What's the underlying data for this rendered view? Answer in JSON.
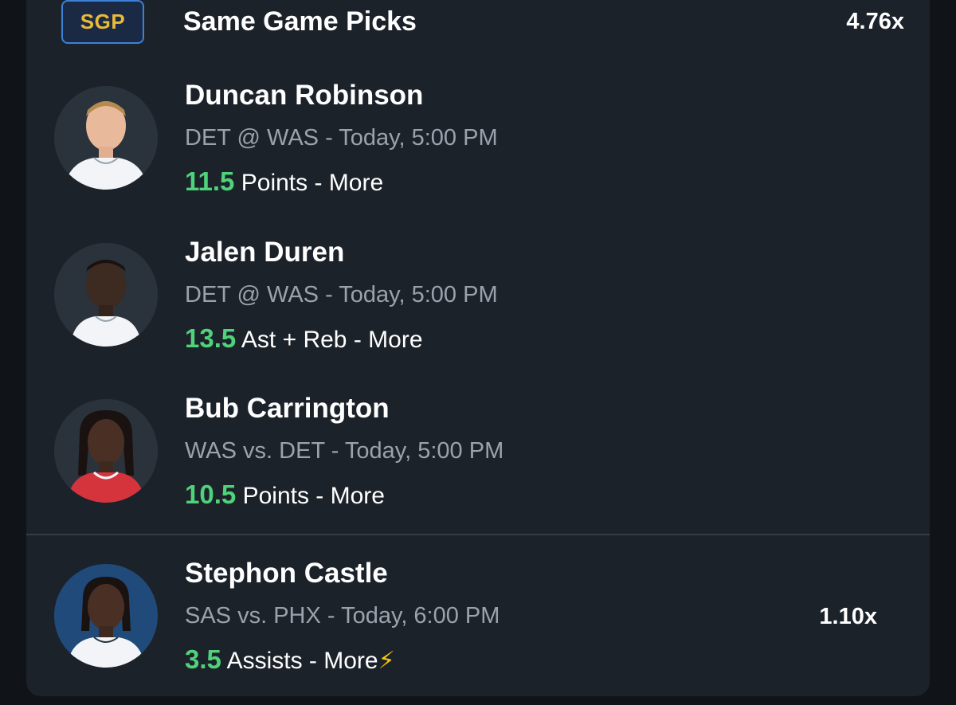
{
  "sgp": {
    "badge": "SGP",
    "title": "Same Game Picks",
    "multiplier": "4.76x",
    "badge_color": "#e8b93b",
    "badge_border": "#3b82d6"
  },
  "picks": [
    {
      "name": "Duncan Robinson",
      "matchup": "DET @ WAS",
      "time": "- Today, 5:00 PM",
      "line_value": "11.5",
      "line_text": "Points - More",
      "jersey_color": "#f2f4f7"
    },
    {
      "name": "Jalen Duren",
      "matchup": "DET @ WAS",
      "time": "- Today, 5:00 PM",
      "line_value": "13.5",
      "line_text": "Ast + Reb - More",
      "jersey_color": "#f2f4f7"
    },
    {
      "name": "Bub Carrington",
      "matchup": "WAS vs. DET",
      "time": "- Today, 5:00 PM",
      "line_value": "10.5",
      "line_text": "Points - More",
      "jersey_color": "#d6343c"
    }
  ],
  "single_pick": {
    "name": "Stephon Castle",
    "matchup": "SAS vs. PHX",
    "time": "- Today, 6:00 PM",
    "line_value": "3.5",
    "line_text": "Assists - More",
    "multiplier": "1.10x",
    "icon": "lightning-bolt-icon",
    "jersey_color": "#f2f4f7",
    "bg_color": "#1f4a7a"
  },
  "colors": {
    "positive": "#4fd27a",
    "muted": "#9aa3ad",
    "card_bg": "#1c222a"
  }
}
